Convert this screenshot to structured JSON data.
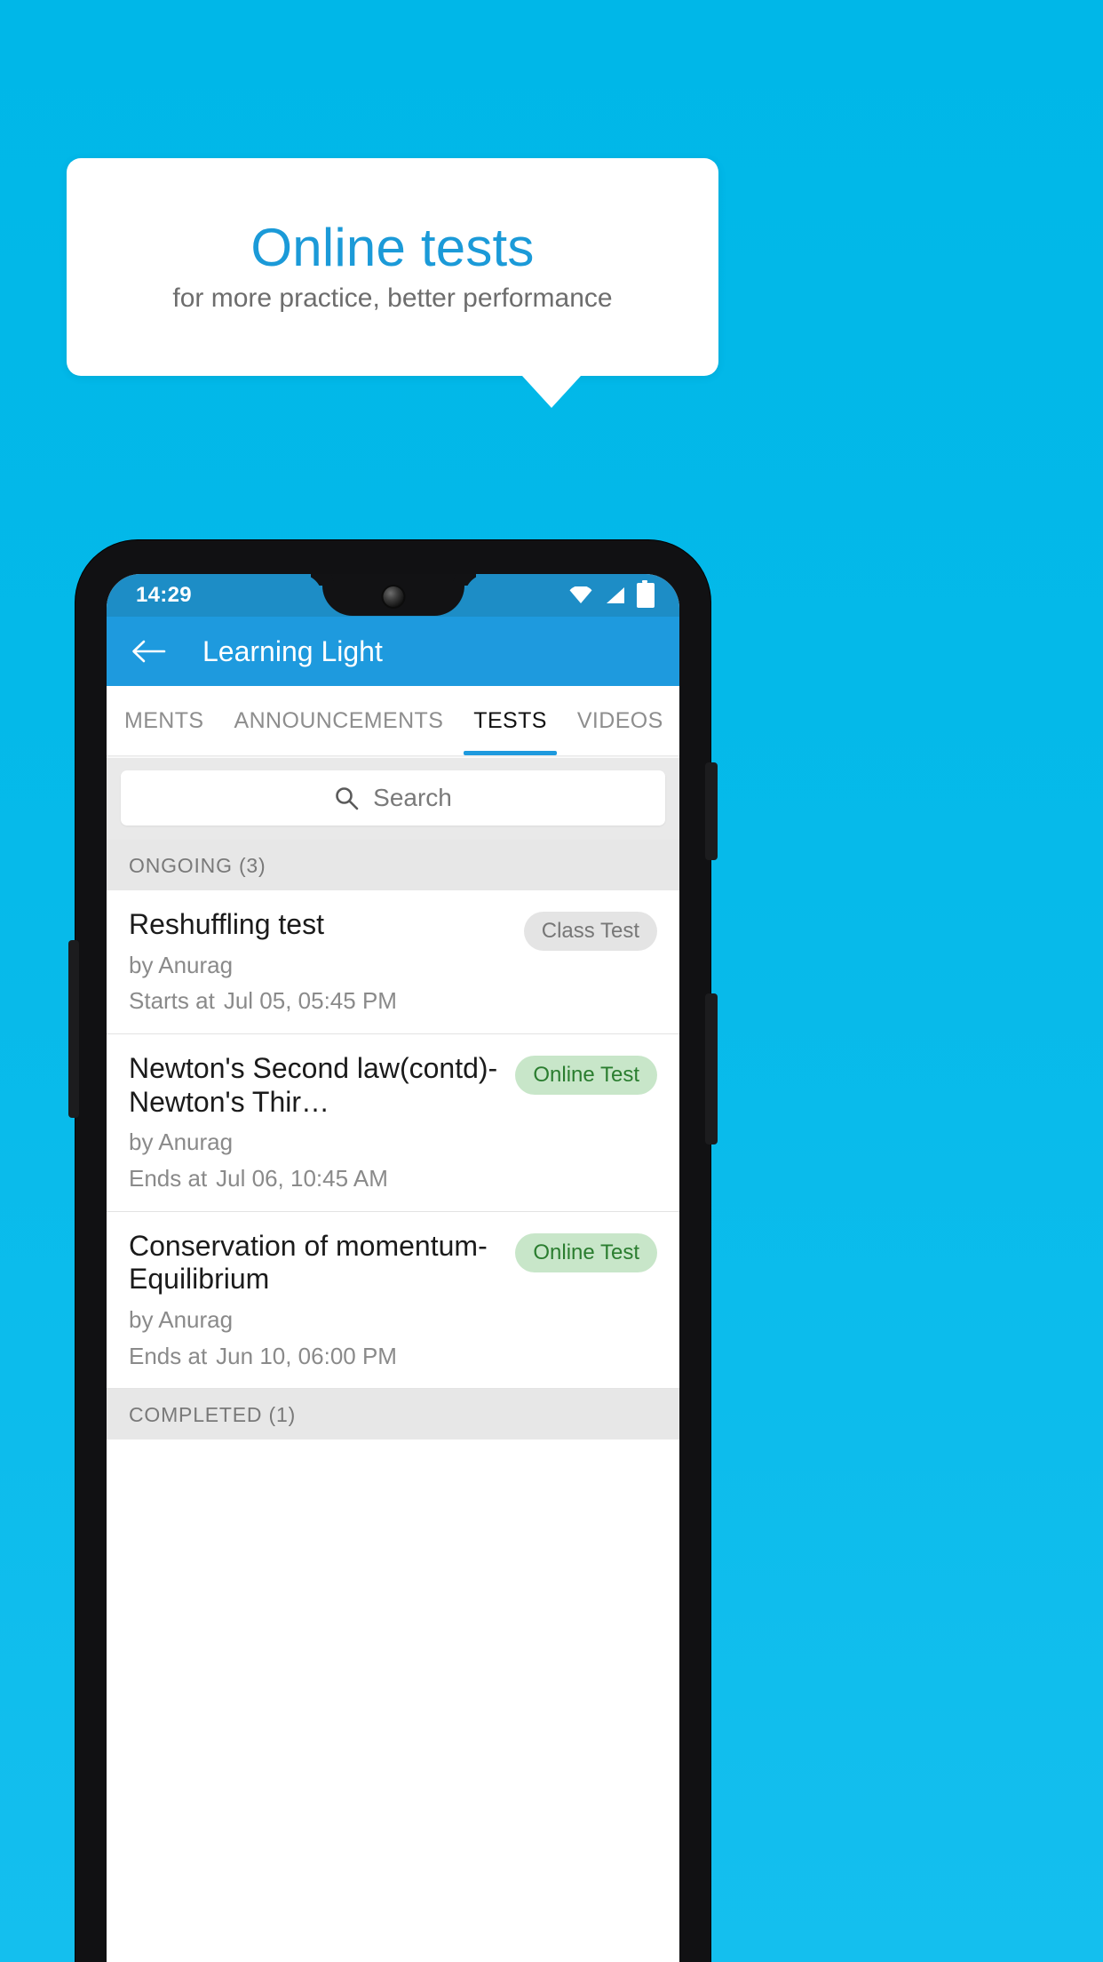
{
  "promo": {
    "title": "Online tests",
    "subtitle": "for more practice, better performance"
  },
  "colors": {
    "background": "#00bbe9",
    "promo_title": "#1b9ad8",
    "appbar": "#1e9ade",
    "statusbar": "#1d8dc6",
    "tab_active": "#1e9ade",
    "badge_online_bg": "#c8e6c9",
    "badge_online_text": "#2a7d2f",
    "badge_class_bg": "#e4e4e4",
    "badge_class_text": "#777777"
  },
  "statusbar": {
    "time": "14:29",
    "icons": [
      "wifi-icon",
      "signal-icon",
      "battery-icon"
    ]
  },
  "appbar": {
    "back_icon": "back-arrow-icon",
    "title": "Learning Light"
  },
  "tabs": [
    {
      "label": "MENTS",
      "active": false
    },
    {
      "label": "ANNOUNCEMENTS",
      "active": false
    },
    {
      "label": "TESTS",
      "active": true
    },
    {
      "label": "VIDEOS",
      "active": false
    }
  ],
  "search": {
    "icon": "search-icon",
    "placeholder": "Search",
    "value": ""
  },
  "sections": [
    {
      "header": "ONGOING (3)",
      "items": [
        {
          "title": "Reshuffling test",
          "author": "by Anurag",
          "time_label": "Starts at",
          "time_value": "Jul 05, 05:45 PM",
          "badge": "Class Test",
          "badge_type": "gray"
        },
        {
          "title": "Newton's Second law(contd)-Newton's Thir…",
          "author": "by Anurag",
          "time_label": "Ends at",
          "time_value": "Jul 06, 10:45 AM",
          "badge": "Online Test",
          "badge_type": "green"
        },
        {
          "title": "Conservation of momentum-Equilibrium",
          "author": "by Anurag",
          "time_label": "Ends at",
          "time_value": "Jun 10, 06:00 PM",
          "badge": "Online Test",
          "badge_type": "green"
        }
      ]
    },
    {
      "header": "COMPLETED (1)",
      "items": []
    }
  ]
}
